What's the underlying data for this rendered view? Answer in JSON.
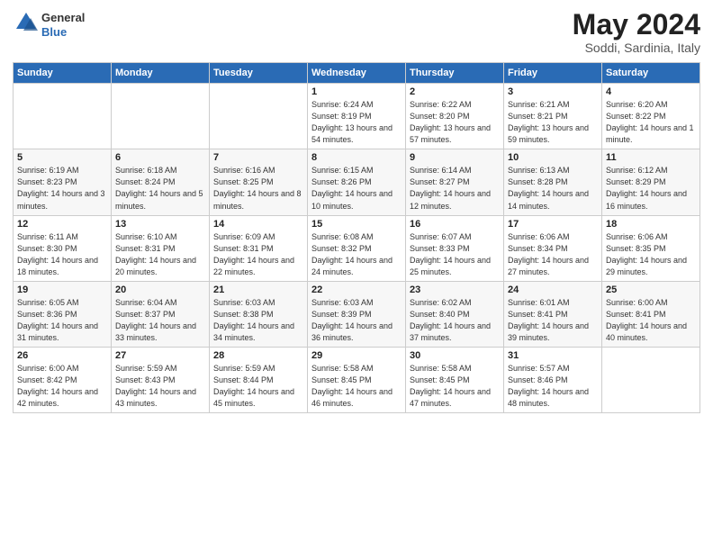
{
  "logo": {
    "general": "General",
    "blue": "Blue"
  },
  "title": "May 2024",
  "location": "Soddi, Sardinia, Italy",
  "weekdays": [
    "Sunday",
    "Monday",
    "Tuesday",
    "Wednesday",
    "Thursday",
    "Friday",
    "Saturday"
  ],
  "weeks": [
    [
      {
        "day": "",
        "sunrise": "",
        "sunset": "",
        "daylight": ""
      },
      {
        "day": "",
        "sunrise": "",
        "sunset": "",
        "daylight": ""
      },
      {
        "day": "",
        "sunrise": "",
        "sunset": "",
        "daylight": ""
      },
      {
        "day": "1",
        "sunrise": "Sunrise: 6:24 AM",
        "sunset": "Sunset: 8:19 PM",
        "daylight": "Daylight: 13 hours and 54 minutes."
      },
      {
        "day": "2",
        "sunrise": "Sunrise: 6:22 AM",
        "sunset": "Sunset: 8:20 PM",
        "daylight": "Daylight: 13 hours and 57 minutes."
      },
      {
        "day": "3",
        "sunrise": "Sunrise: 6:21 AM",
        "sunset": "Sunset: 8:21 PM",
        "daylight": "Daylight: 13 hours and 59 minutes."
      },
      {
        "day": "4",
        "sunrise": "Sunrise: 6:20 AM",
        "sunset": "Sunset: 8:22 PM",
        "daylight": "Daylight: 14 hours and 1 minute."
      }
    ],
    [
      {
        "day": "5",
        "sunrise": "Sunrise: 6:19 AM",
        "sunset": "Sunset: 8:23 PM",
        "daylight": "Daylight: 14 hours and 3 minutes."
      },
      {
        "day": "6",
        "sunrise": "Sunrise: 6:18 AM",
        "sunset": "Sunset: 8:24 PM",
        "daylight": "Daylight: 14 hours and 5 minutes."
      },
      {
        "day": "7",
        "sunrise": "Sunrise: 6:16 AM",
        "sunset": "Sunset: 8:25 PM",
        "daylight": "Daylight: 14 hours and 8 minutes."
      },
      {
        "day": "8",
        "sunrise": "Sunrise: 6:15 AM",
        "sunset": "Sunset: 8:26 PM",
        "daylight": "Daylight: 14 hours and 10 minutes."
      },
      {
        "day": "9",
        "sunrise": "Sunrise: 6:14 AM",
        "sunset": "Sunset: 8:27 PM",
        "daylight": "Daylight: 14 hours and 12 minutes."
      },
      {
        "day": "10",
        "sunrise": "Sunrise: 6:13 AM",
        "sunset": "Sunset: 8:28 PM",
        "daylight": "Daylight: 14 hours and 14 minutes."
      },
      {
        "day": "11",
        "sunrise": "Sunrise: 6:12 AM",
        "sunset": "Sunset: 8:29 PM",
        "daylight": "Daylight: 14 hours and 16 minutes."
      }
    ],
    [
      {
        "day": "12",
        "sunrise": "Sunrise: 6:11 AM",
        "sunset": "Sunset: 8:30 PM",
        "daylight": "Daylight: 14 hours and 18 minutes."
      },
      {
        "day": "13",
        "sunrise": "Sunrise: 6:10 AM",
        "sunset": "Sunset: 8:31 PM",
        "daylight": "Daylight: 14 hours and 20 minutes."
      },
      {
        "day": "14",
        "sunrise": "Sunrise: 6:09 AM",
        "sunset": "Sunset: 8:31 PM",
        "daylight": "Daylight: 14 hours and 22 minutes."
      },
      {
        "day": "15",
        "sunrise": "Sunrise: 6:08 AM",
        "sunset": "Sunset: 8:32 PM",
        "daylight": "Daylight: 14 hours and 24 minutes."
      },
      {
        "day": "16",
        "sunrise": "Sunrise: 6:07 AM",
        "sunset": "Sunset: 8:33 PM",
        "daylight": "Daylight: 14 hours and 25 minutes."
      },
      {
        "day": "17",
        "sunrise": "Sunrise: 6:06 AM",
        "sunset": "Sunset: 8:34 PM",
        "daylight": "Daylight: 14 hours and 27 minutes."
      },
      {
        "day": "18",
        "sunrise": "Sunrise: 6:06 AM",
        "sunset": "Sunset: 8:35 PM",
        "daylight": "Daylight: 14 hours and 29 minutes."
      }
    ],
    [
      {
        "day": "19",
        "sunrise": "Sunrise: 6:05 AM",
        "sunset": "Sunset: 8:36 PM",
        "daylight": "Daylight: 14 hours and 31 minutes."
      },
      {
        "day": "20",
        "sunrise": "Sunrise: 6:04 AM",
        "sunset": "Sunset: 8:37 PM",
        "daylight": "Daylight: 14 hours and 33 minutes."
      },
      {
        "day": "21",
        "sunrise": "Sunrise: 6:03 AM",
        "sunset": "Sunset: 8:38 PM",
        "daylight": "Daylight: 14 hours and 34 minutes."
      },
      {
        "day": "22",
        "sunrise": "Sunrise: 6:03 AM",
        "sunset": "Sunset: 8:39 PM",
        "daylight": "Daylight: 14 hours and 36 minutes."
      },
      {
        "day": "23",
        "sunrise": "Sunrise: 6:02 AM",
        "sunset": "Sunset: 8:40 PM",
        "daylight": "Daylight: 14 hours and 37 minutes."
      },
      {
        "day": "24",
        "sunrise": "Sunrise: 6:01 AM",
        "sunset": "Sunset: 8:41 PM",
        "daylight": "Daylight: 14 hours and 39 minutes."
      },
      {
        "day": "25",
        "sunrise": "Sunrise: 6:00 AM",
        "sunset": "Sunset: 8:41 PM",
        "daylight": "Daylight: 14 hours and 40 minutes."
      }
    ],
    [
      {
        "day": "26",
        "sunrise": "Sunrise: 6:00 AM",
        "sunset": "Sunset: 8:42 PM",
        "daylight": "Daylight: 14 hours and 42 minutes."
      },
      {
        "day": "27",
        "sunrise": "Sunrise: 5:59 AM",
        "sunset": "Sunset: 8:43 PM",
        "daylight": "Daylight: 14 hours and 43 minutes."
      },
      {
        "day": "28",
        "sunrise": "Sunrise: 5:59 AM",
        "sunset": "Sunset: 8:44 PM",
        "daylight": "Daylight: 14 hours and 45 minutes."
      },
      {
        "day": "29",
        "sunrise": "Sunrise: 5:58 AM",
        "sunset": "Sunset: 8:45 PM",
        "daylight": "Daylight: 14 hours and 46 minutes."
      },
      {
        "day": "30",
        "sunrise": "Sunrise: 5:58 AM",
        "sunset": "Sunset: 8:45 PM",
        "daylight": "Daylight: 14 hours and 47 minutes."
      },
      {
        "day": "31",
        "sunrise": "Sunrise: 5:57 AM",
        "sunset": "Sunset: 8:46 PM",
        "daylight": "Daylight: 14 hours and 48 minutes."
      },
      {
        "day": "",
        "sunrise": "",
        "sunset": "",
        "daylight": ""
      }
    ]
  ]
}
